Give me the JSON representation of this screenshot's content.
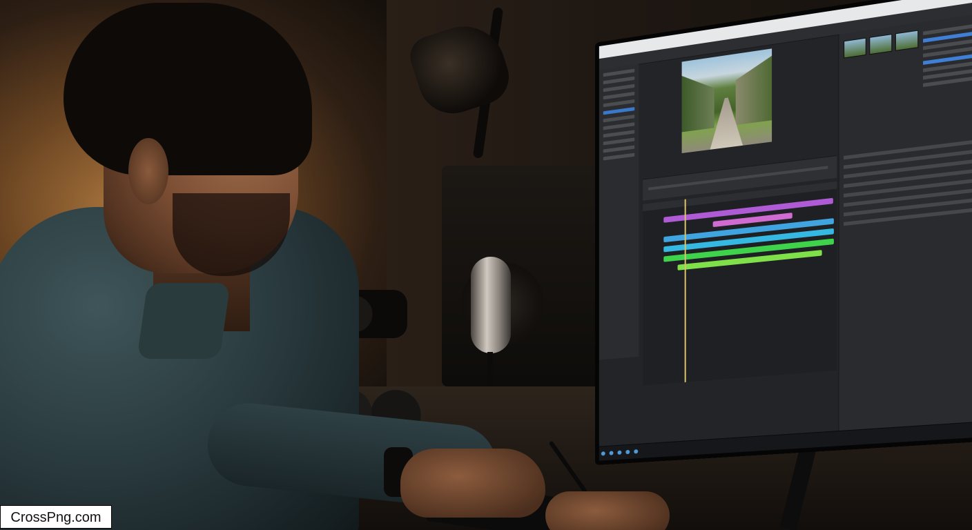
{
  "image": {
    "kind": "photograph",
    "subject": "video-editor-at-monitor"
  },
  "watermark": {
    "text": "CrossPng.com"
  },
  "colors": {
    "track_purple": "#b05bd6",
    "track_pink": "#d06bd2",
    "track_blue": "#3fa4e0",
    "track_cyan": "#35b8e2",
    "track_green": "#3fd34b",
    "track_lime": "#7fe04a",
    "accent_blue": "#3a78c9"
  },
  "icons": [
    "lamp-icon",
    "microphone-icon",
    "headphones-icon",
    "speaker-icon",
    "camera-icon",
    "keyboard-icon",
    "pen-icon",
    "watch-icon"
  ]
}
